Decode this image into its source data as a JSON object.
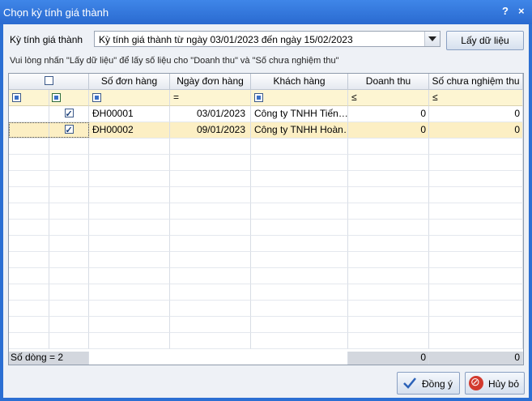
{
  "window": {
    "title": "Chọn kỳ tính giá thành",
    "help_label": "?",
    "close_label": "×"
  },
  "period": {
    "label": "Kỳ tính giá thành",
    "value": "Kỳ tính giá thành từ ngày 03/01/2023 đến ngày 15/02/2023",
    "fetch_label": "Lấy dữ liệu"
  },
  "hint": "Vui lòng nhấn \"Lấy dữ liệu\" để lấy số liệu cho \"Doanh thu\" và \"Số chưa nghiệm thu\"",
  "grid": {
    "columns": [
      "",
      "Số đơn hàng",
      "Ngày đơn hàng",
      "Khách hàng",
      "Doanh thu",
      "Số chưa nghiệm thu"
    ],
    "filter_ops": {
      "date": "=",
      "revenue": "≤",
      "unaccepted": "≤"
    },
    "rows": [
      {
        "checked": true,
        "order_no": "ĐH00001",
        "order_date": "03/01/2023",
        "customer": "Công ty TNHH Tiến…",
        "revenue": "0",
        "unaccepted": "0"
      },
      {
        "checked": true,
        "order_no": "ĐH00002",
        "order_date": "09/01/2023",
        "customer": "Công ty TNHH Hoàn…",
        "revenue": "0",
        "unaccepted": "0"
      }
    ],
    "footer": {
      "count_label": "Số dòng = 2",
      "revenue_total": "0",
      "unaccepted_total": "0"
    }
  },
  "buttons": {
    "ok": "Đồng ý",
    "cancel": "Hủy bỏ"
  },
  "colors": {
    "title_bar": "#2a6ad0",
    "filter_row": "#fdf5d2",
    "selected_row": "#fcefc4"
  }
}
